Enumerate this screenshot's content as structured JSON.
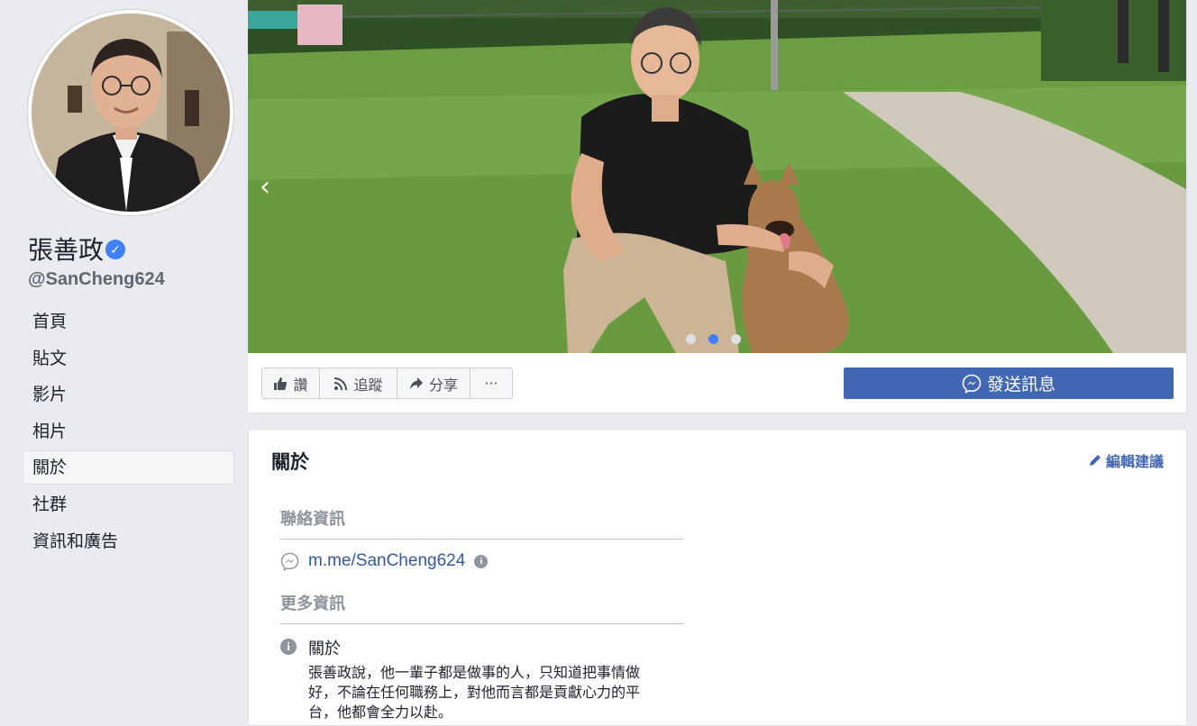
{
  "profile": {
    "name": "張善政",
    "handle": "@SanCheng624"
  },
  "nav": {
    "items": [
      {
        "label": "首頁"
      },
      {
        "label": "貼文"
      },
      {
        "label": "影片"
      },
      {
        "label": "相片"
      },
      {
        "label": "關於",
        "active": true
      },
      {
        "label": "社群"
      },
      {
        "label": "資訊和廣告"
      }
    ]
  },
  "cover": {
    "slide_count": 3,
    "active_slide": 2
  },
  "actions": {
    "like_label": "讚",
    "follow_label": "追蹤",
    "share_label": "分享",
    "more_label": "···",
    "send_message_label": "發送訊息"
  },
  "about": {
    "title": "關於",
    "edit_label": "編輯建議",
    "contact_heading": "聯絡資訊",
    "messenger_link": "m.me/SanCheng624",
    "more_heading": "更多資訊",
    "about_subtitle": "關於",
    "about_text": "張善政說，他一輩子都是做事的人，只知道把事情做好，不論在任何職務上，對他而言都是貢獻心力的平台，他都會全力以赴。"
  },
  "colors": {
    "brand_blue": "#4267b2",
    "link_blue": "#365899",
    "verified_blue": "#4080ff",
    "page_bg": "#e9ebee"
  },
  "icons": [
    "verified-badge-icon",
    "thumbs-up-icon",
    "rss-icon",
    "share-arrow-icon",
    "more-icon",
    "messenger-icon",
    "pencil-icon",
    "info-icon",
    "chevron-left-icon"
  ]
}
